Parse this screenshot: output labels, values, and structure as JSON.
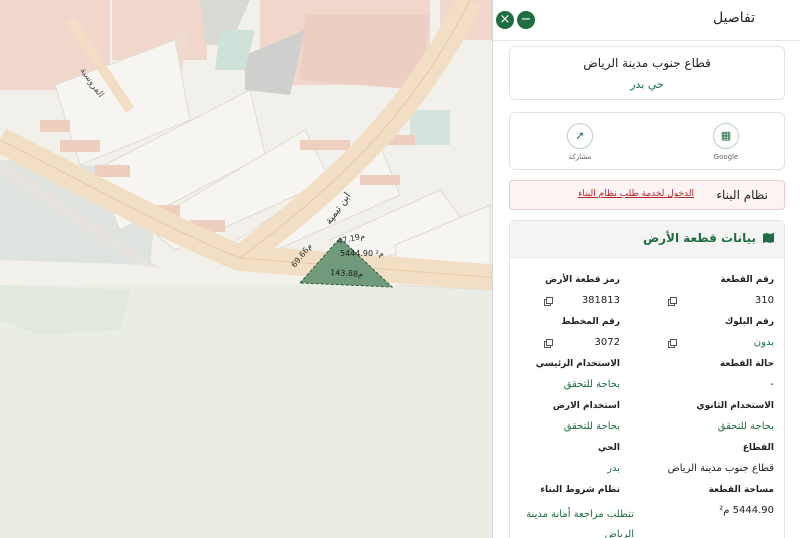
{
  "panel": {
    "title": "تفاصيل",
    "close_glyph": "×",
    "minimize_glyph": "−"
  },
  "location": {
    "title": "قطاع جنوب مدينة الرياض",
    "district": "حي بدر"
  },
  "actions": {
    "google_label": "Google",
    "share_label": "مشاركة"
  },
  "building_system": {
    "label": "نظام البناء",
    "link": "الدخول لخدمة طلب نظام البناء"
  },
  "land": {
    "header": "بيانات قطعة الأرض",
    "fields": {
      "parcel_no": {
        "label": "رقم القطعة",
        "value": "310"
      },
      "land_code": {
        "label": "رمز قطعة الأرض",
        "value": "381813"
      },
      "block_no": {
        "label": "رقم البلوك",
        "value": "بدون"
      },
      "plan_no": {
        "label": "رقم المخطط",
        "value": "3072"
      },
      "parcel_status": {
        "label": "حالة القطعة",
        "value": "-"
      },
      "main_use": {
        "label": "الاستخدام الرئيسي",
        "value": "بحاجة للتحقق"
      },
      "secondary_use": {
        "label": "الاستخدام الثانوي",
        "value": "بحاجة للتحقق"
      },
      "land_use": {
        "label": "استخدام الارض",
        "value": "بحاجة للتحقق"
      },
      "sector": {
        "label": "القطاع",
        "value": "قطاع جنوب مدينة الرياض"
      },
      "district": {
        "label": "الحي",
        "value": "بدر"
      },
      "area": {
        "label": "مساحة القطعة",
        "value": "5444.90 م²"
      },
      "building_conditions": {
        "label": "نظام شروط البناء",
        "value": "تتطلب مراجعة أمانة مدينة الرياض"
      }
    }
  },
  "map": {
    "street_1": "ابن تيمية",
    "street_2": "الفروسية",
    "dim_1": "69.66م",
    "dim_2": "47.19م",
    "dim_3": "143.88م",
    "parcel_area": "5444.90 م²"
  },
  "colors": {
    "accent": "#1f6e43",
    "danger": "#b4262a",
    "parcel_fill": "#6f9a7b"
  }
}
